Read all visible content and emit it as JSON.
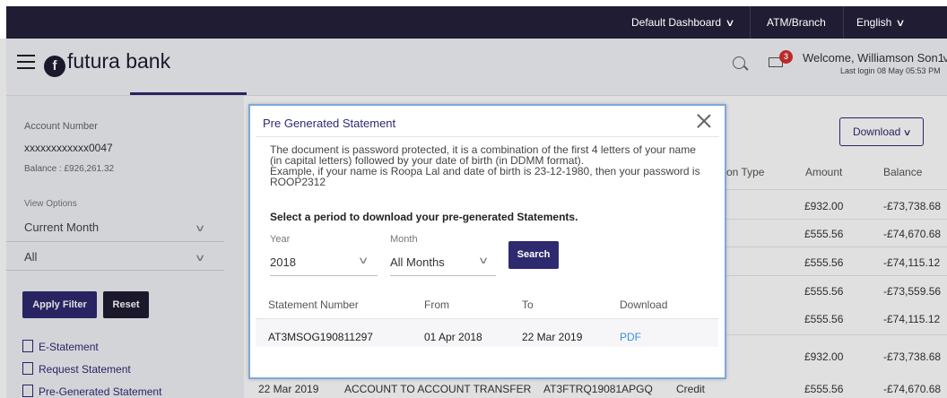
{
  "topbar": {
    "dashboard_label": "Default Dashboard",
    "atm_branch_label": "ATM/Branch",
    "language_label": "English"
  },
  "header": {
    "brand": "futura bank",
    "notification_count": "3",
    "welcome": "Welcome, Williamson Son1",
    "last_login": "Last login 08 May 05:53 PM"
  },
  "left_panel": {
    "account_number_label": "Account Number",
    "account_number": "xxxxxxxxxxxx0047",
    "balance": "Balance : £926,261.32",
    "view_options_label": "View Options",
    "period_value": "Current Month",
    "type_value": "All",
    "apply_label": "Apply Filter",
    "reset_label": "Reset",
    "links": [
      "E-Statement",
      "Request Statement",
      "Pre-Generated Statement"
    ]
  },
  "background_table": {
    "download_label": "Download",
    "headers": {
      "type": "on Type",
      "amount": "Amount",
      "balance": "Balance"
    },
    "rows": [
      {
        "amount": "£932.00",
        "balance": "-£73,738.68"
      },
      {
        "amount": "£555.56",
        "balance": "-£74,670.68"
      },
      {
        "amount": "£555.56",
        "balance": "-£74,115.12"
      },
      {
        "amount": "£555.56",
        "balance": "-£73,559.56"
      },
      {
        "amount": "£555.56",
        "balance": "-£74,115.12"
      },
      {
        "amount": "£932.00",
        "balance": "-£73,738.68"
      }
    ],
    "last_row": {
      "date": "22 Mar 2019",
      "description": "ACCOUNT TO ACCOUNT TRANSFER",
      "reference": "AT3FTRQ19081APGQ",
      "type": "Credit",
      "amount": "£555.56",
      "balance": "-£74,670.68"
    }
  },
  "modal": {
    "title": "Pre Generated Statement",
    "description": "The document is password protected, it is a combination of the first 4 letters of your name (in capital letters) followed by your date of birth (in DDMM format).",
    "example": "Example, if your name is Roopa Lal and date of birth is 23-12-1980, then your password is ROOP2312",
    "subtitle": "Select a period to download your pre-generated Statements.",
    "year_label": "Year",
    "year_value": "2018",
    "month_label": "Month",
    "month_value": "All Months",
    "search_label": "Search",
    "table_headers": {
      "statement_number": "Statement Number",
      "from": "From",
      "to": "To",
      "download": "Download"
    },
    "rows": [
      {
        "statement_number": "AT3MSOG190811297",
        "from": "01 Apr 2018",
        "to": "22 Mar 2019",
        "download": "PDF"
      }
    ]
  },
  "colors": {
    "topbar": "#1f1c33",
    "primary": "#2e2a70",
    "modal_border": "#7ea8d8",
    "badge": "#d62f2f",
    "link": "#3a8ee6"
  }
}
